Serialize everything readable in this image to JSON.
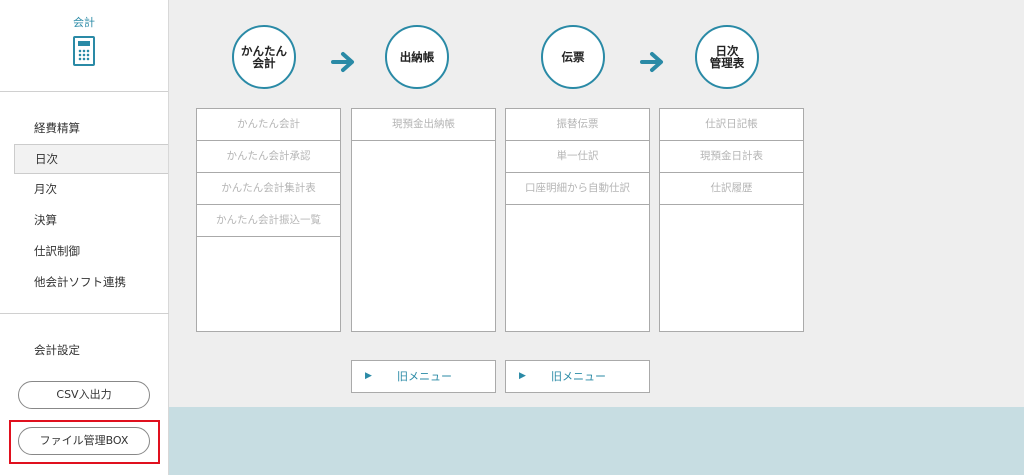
{
  "app": {
    "title": "会計",
    "icon": "calculator-icon"
  },
  "sidebar": {
    "items": [
      {
        "label": "経費精算"
      },
      {
        "label": "日次"
      },
      {
        "label": "月次"
      },
      {
        "label": "決算"
      },
      {
        "label": "仕訳制御"
      },
      {
        "label": "他会計ソフト連携"
      }
    ],
    "active_index": 1,
    "settings_label": "会計設定",
    "csv_button": "CSV入出力",
    "file_box_button": "ファイル管理BOX"
  },
  "flow": {
    "circles": [
      {
        "label": "かんたん\n会計"
      },
      {
        "label": "出納帳"
      },
      {
        "label": "伝票"
      },
      {
        "label": "日次\n管理表"
      }
    ],
    "arrow_icon": "arrow-right-icon",
    "accent_color": "#2a8aa6"
  },
  "columns": [
    {
      "items": [
        "かんたん会計",
        "かんたん会計承認",
        "かんたん会計集計表",
        "かんたん会計振込一覧"
      ]
    },
    {
      "items": [
        "現預金出納帳"
      ]
    },
    {
      "items": [
        "振替伝票",
        "単一仕訳",
        "口座明細から自動仕訳"
      ]
    },
    {
      "items": [
        "仕訳日記帳",
        "現預金日計表",
        "仕訳履歴"
      ]
    }
  ],
  "old_menu": {
    "label": "旧メニュー",
    "icon": "play-triangle-icon"
  },
  "colors": {
    "main_bg": "#eeeeee",
    "bottom_band": "#c7dde2",
    "highlight": "#e0101e",
    "disabled_text": "#b5b5b5"
  }
}
